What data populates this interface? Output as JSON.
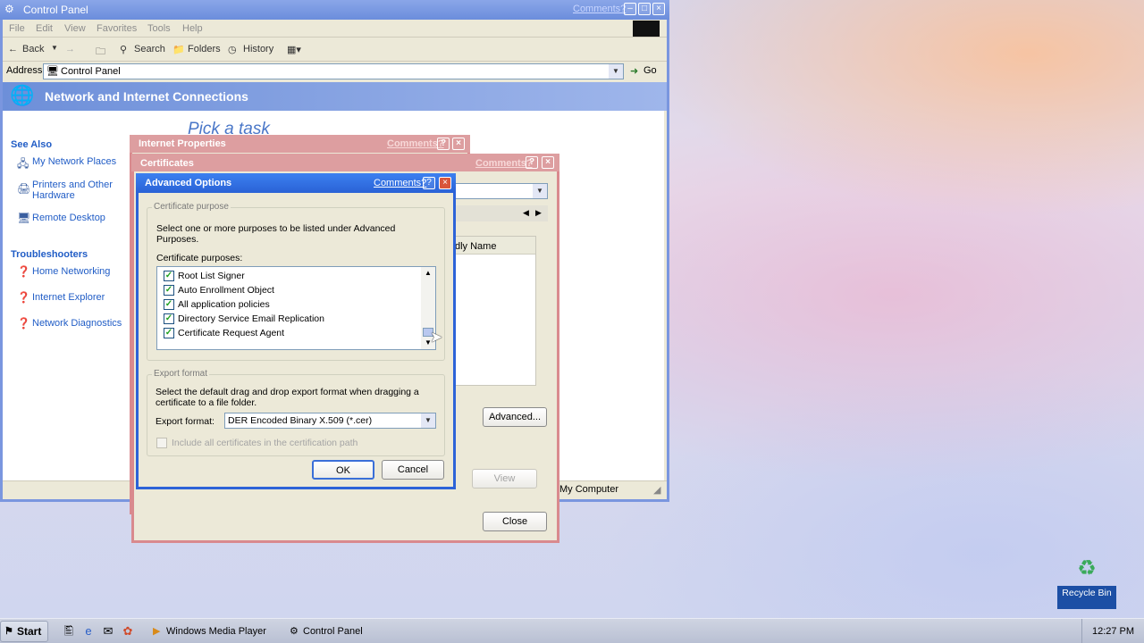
{
  "control_panel": {
    "title": "Control Panel",
    "comments": "Comments?",
    "menu": [
      "File",
      "Edit",
      "View",
      "Favorites",
      "Tools",
      "Help"
    ],
    "toolbar": {
      "back": "Back",
      "search": "Search",
      "folders": "Folders",
      "history": "History"
    },
    "address_label": "Address",
    "address_value": "Control Panel",
    "go": "Go",
    "category_title": "Network and Internet Connections",
    "pick_task": "Pick a task",
    "see_also_heading": "See Also",
    "see_also": [
      "My Network Places",
      "Printers and Other Hardware",
      "Remote Desktop"
    ],
    "troubleshooters_heading": "Troubleshooters",
    "troubleshooters": [
      "Home Networking",
      "Internet Explorer",
      "Network Diagnostics"
    ],
    "status_zone": "My Computer"
  },
  "internet_properties": {
    "title": "Internet Properties",
    "comments": "Comments?"
  },
  "certificates": {
    "title": "Certificates",
    "comments": "Comments?",
    "column_partial": "dly Name",
    "advanced_button": "Advanced...",
    "view_button": "View",
    "close_button": "Close"
  },
  "advanced_options": {
    "title": "Advanced Options",
    "comments": "Comments?",
    "purpose_group": "Certificate purpose",
    "purpose_desc": "Select one or more purposes to be listed under Advanced Purposes.",
    "purposes_label": "Certificate purposes:",
    "purposes": [
      {
        "label": "Root List Signer",
        "checked": true
      },
      {
        "label": "Auto Enrollment Object",
        "checked": true
      },
      {
        "label": "All application policies",
        "checked": true
      },
      {
        "label": "Directory Service Email Replication",
        "checked": true
      },
      {
        "label": "Certificate Request Agent",
        "checked": true
      }
    ],
    "export_group": "Export format",
    "export_desc": "Select the default drag and drop export format when dragging a certificate to a file folder.",
    "export_label": "Export format:",
    "export_value": "DER Encoded Binary X.509 (*.cer)",
    "include_all": "Include all certificates in the certification path",
    "ok": "OK",
    "cancel": "Cancel"
  },
  "taskbar": {
    "start": "Start",
    "tasks": [
      "Windows Media Player",
      "Control Panel"
    ],
    "clock": "12:27 PM"
  },
  "desktop": {
    "recycle_bin": "Recycle Bin"
  }
}
